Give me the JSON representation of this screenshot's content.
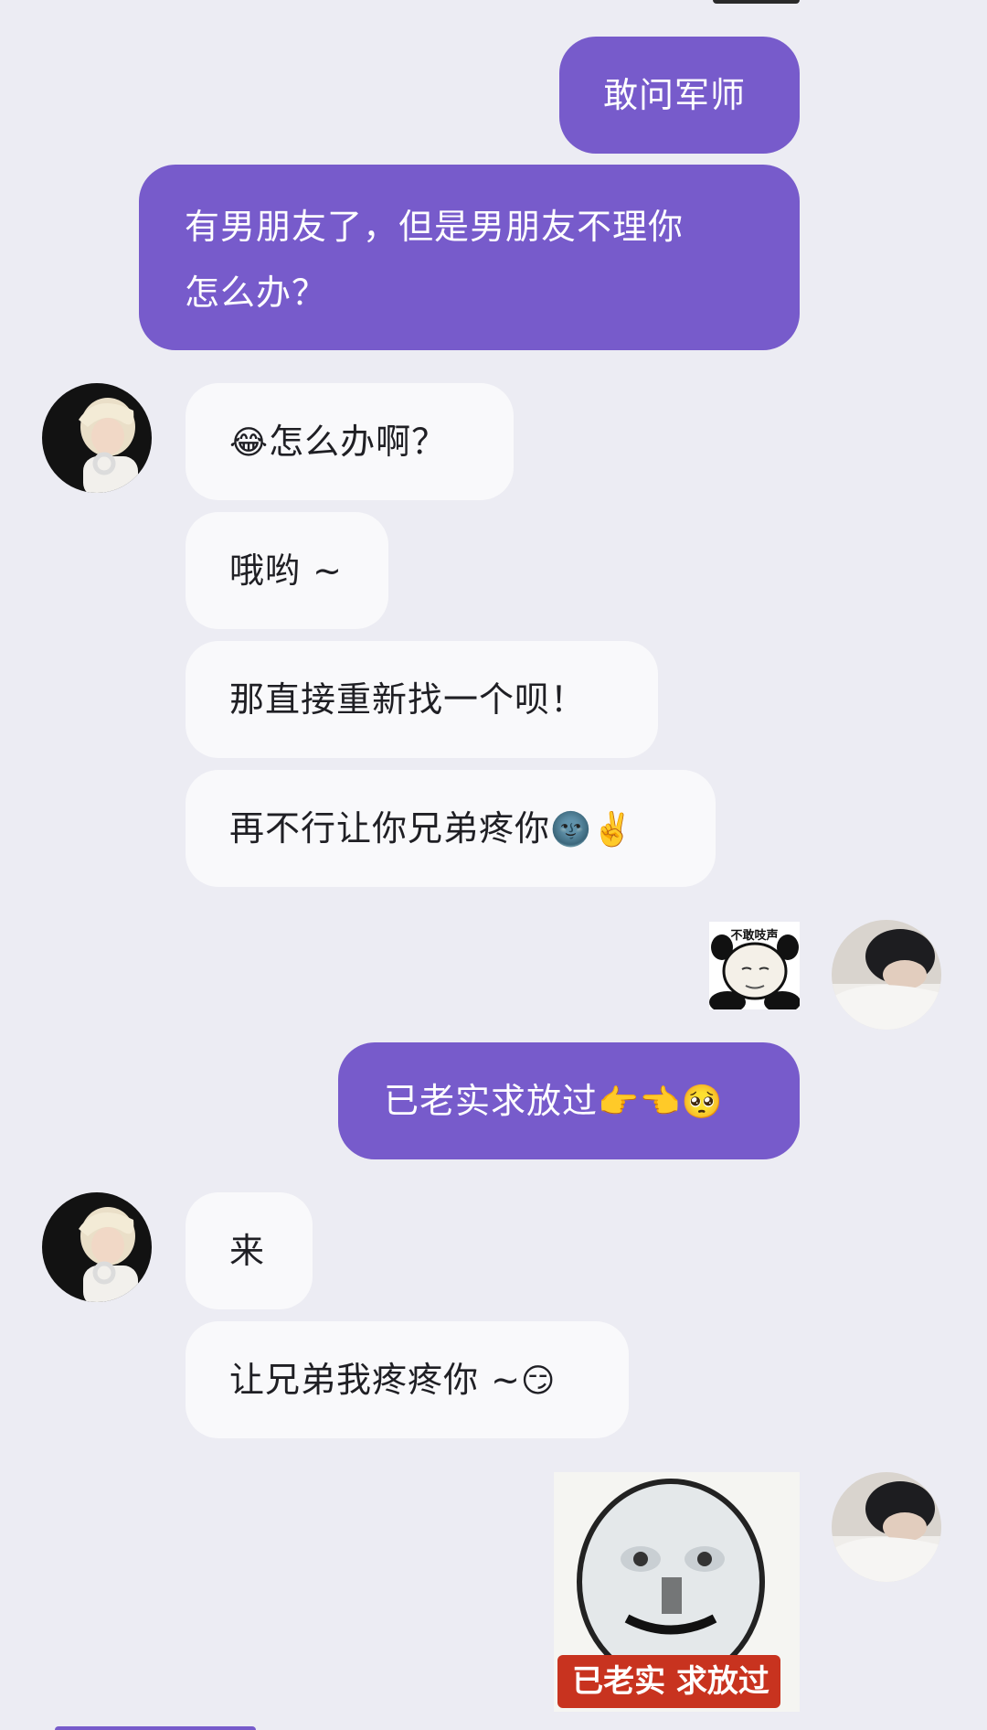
{
  "colors": {
    "background": "#ECECF3",
    "outgoing_bubble": "#775BCB",
    "incoming_bubble": "#F9F9FB",
    "outgoing_text": "#FFFFFF",
    "incoming_text": "#1F1F24"
  },
  "messages": {
    "m1": {
      "text": "敢问军师"
    },
    "m2": {
      "line1": "有男朋友了，但是男朋友不理你",
      "line2": "怎么办？"
    },
    "m3": {
      "emoji": "😂",
      "text": "怎么办啊？"
    },
    "m4": {
      "text": "哦哟 ~"
    },
    "m5": {
      "text": "那直接重新找一个呗！"
    },
    "m6": {
      "text": "再不行让你兄弟疼你",
      "emoji": "🌚✌️"
    },
    "m7": {
      "sticker_text": "不敢吱声"
    },
    "m8": {
      "text": "已老实求放过",
      "emoji": "👉👈🥺"
    },
    "m9": {
      "text": "来"
    },
    "m10": {
      "text": "让兄弟我疼疼你 ~",
      "emoji": "😏"
    },
    "m11": {
      "sticker_caption": "已老实 求放过"
    }
  },
  "avatars": {
    "other": "blond-boy-with-headphones-avatar",
    "self": "dark-haired-boy-lying-avatar"
  }
}
